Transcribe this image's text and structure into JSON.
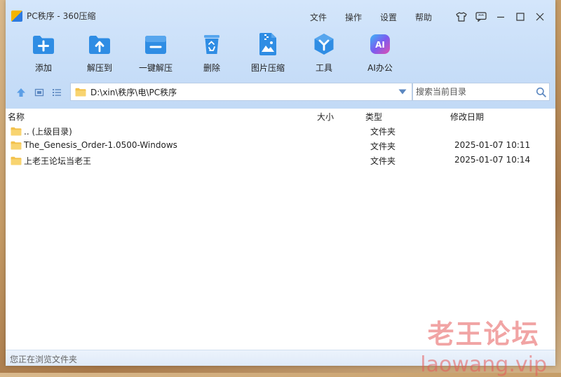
{
  "window": {
    "title": "PC秩序 - 360压缩"
  },
  "menu": [
    {
      "label": "文件"
    },
    {
      "label": "操作"
    },
    {
      "label": "设置"
    },
    {
      "label": "帮助"
    }
  ],
  "toolbar": [
    {
      "label": "添加",
      "icon": "add-icon",
      "color": "#2f8de4"
    },
    {
      "label": "解压到",
      "icon": "extract-to-icon",
      "color": "#2f8de4"
    },
    {
      "label": "一键解压",
      "icon": "one-click-extract-icon",
      "color": "#2f8de4"
    },
    {
      "label": "删除",
      "icon": "recycle-bin-icon",
      "color": "#2f8de4"
    },
    {
      "label": "图片压缩",
      "icon": "image-compress-icon",
      "color": "#2f8de4"
    },
    {
      "label": "工具",
      "icon": "tools-icon",
      "color": "#2f8de4"
    },
    {
      "label": "AI办公",
      "icon": "ai-office-icon",
      "icon_text": "AI",
      "color": "#7b5cf0"
    }
  ],
  "address": {
    "path": "D:\\xin\\秩序\\电\\PC秩序"
  },
  "search": {
    "placeholder": "搜索当前目录"
  },
  "columns": {
    "name": "名称",
    "size": "大小",
    "type": "类型",
    "date": "修改日期"
  },
  "files": [
    {
      "name": ".. (上级目录)",
      "size": "",
      "type": "文件夹",
      "date": ""
    },
    {
      "name": "The_Genesis_Order-1.0500-Windows",
      "size": "",
      "type": "文件夹",
      "date": "2025-01-07 10:11"
    },
    {
      "name": "上老王论坛当老王",
      "size": "",
      "type": "文件夹",
      "date": "2025-01-07 10:14"
    }
  ],
  "status": {
    "text": "您正在浏览文件夹"
  },
  "watermark": {
    "title": "老王论坛",
    "url": "laowang.vip"
  }
}
